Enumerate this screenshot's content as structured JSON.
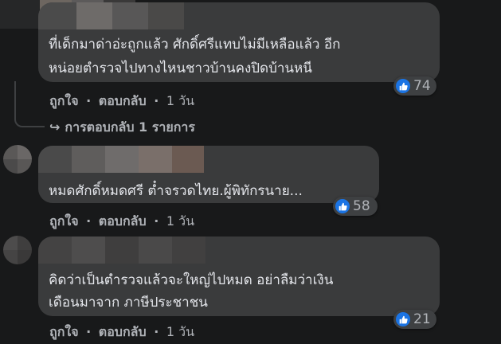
{
  "comments": [
    {
      "lines": [
        "ที่เด็กมาด่าอ่ะถูกแล้ว ศักดิ์ศรีแทบไม่มีเหลือแล้ว อีก",
        "หน่อยตำรวจไปทางไหนชาวบ้านคงปิดบ้านหนี"
      ],
      "like_label": "ถูกใจ",
      "reply_label": "ตอบกลับ",
      "time": "1 วัน",
      "reaction_count": "74",
      "replies_link": "การตอบกลับ 1 รายการ"
    },
    {
      "lines": [
        "หมดศักดิ์หมดศรี ต๋ำจรวดไทย.ผู้พิทักรนาย..."
      ],
      "like_label": "ถูกใจ",
      "reply_label": "ตอบกลับ",
      "time": "1 วัน",
      "reaction_count": "58"
    },
    {
      "lines": [
        "คิดว่าเป็นตำรวจแล้วจะใหญ่ไปหมด อย่าลืมว่าเงิน",
        "เดือนมาจาก ภาษีประชาชน"
      ],
      "like_label": "ถูกใจ",
      "reply_label": "ตอบกลับ",
      "time": "1 วัน",
      "reaction_count": "21"
    }
  ],
  "separator": "·",
  "reaction_icon": "thumbs-up-icon",
  "reply_arrow_icon": "reply-arrow-icon",
  "colors": {
    "background": "#18191a",
    "bubble": "#3a3b3c",
    "like_blue": "#1b74e4",
    "secondary_text": "#b0b3b8"
  }
}
